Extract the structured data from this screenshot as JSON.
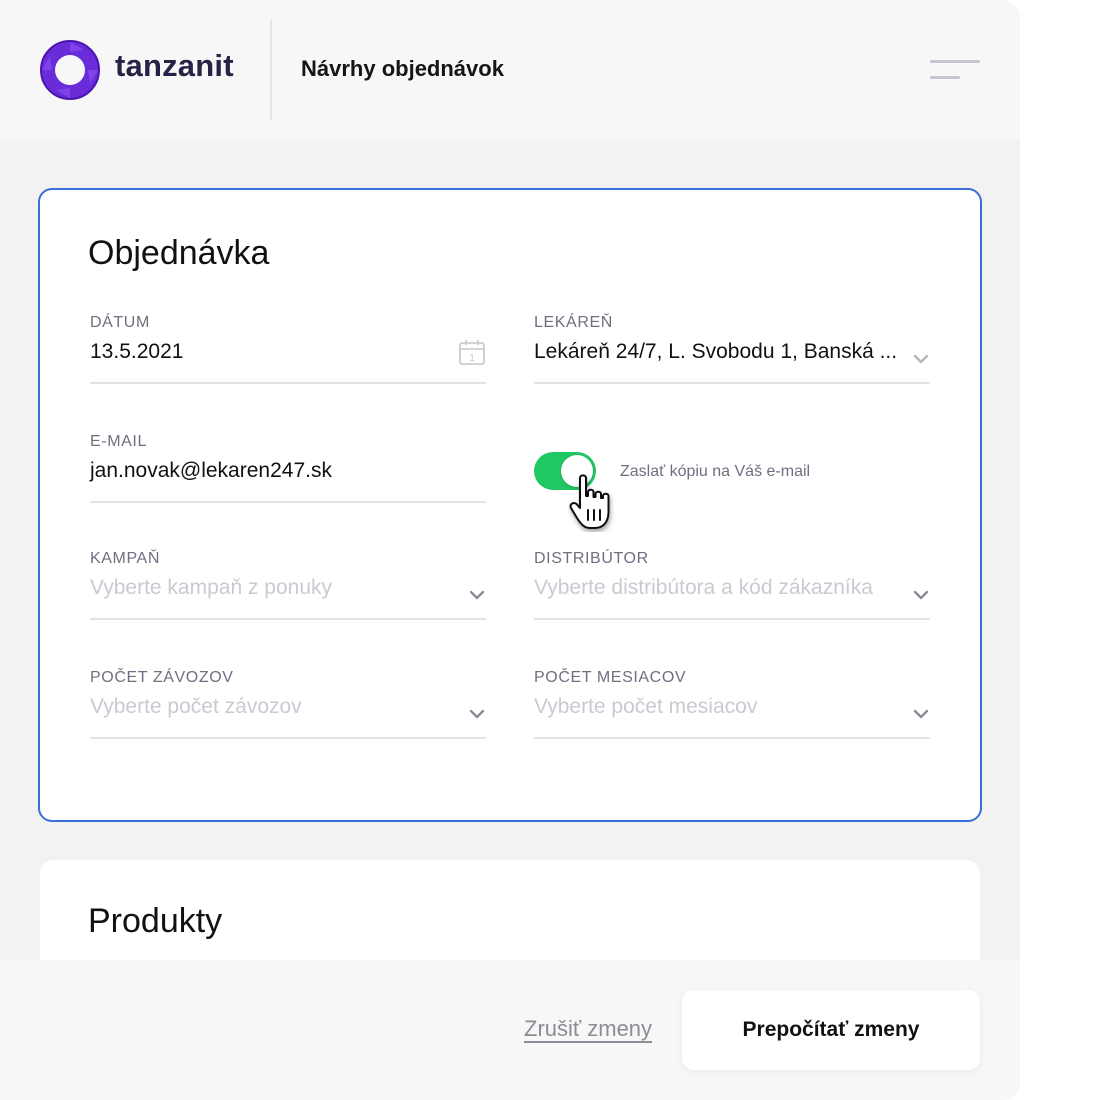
{
  "header": {
    "brand": "tanzanit",
    "page_title": "Návrhy objednávok"
  },
  "order_card": {
    "title": "Objednávka",
    "date": {
      "label": "DÁTUM",
      "value": "13.5.2021",
      "calendar_day": "1"
    },
    "pharmacy": {
      "label": "LEKÁREŇ",
      "value": "Lekáreň 24/7, L. Svobodu 1, Banská ..."
    },
    "email": {
      "label": "E-MAIL",
      "value": "jan.novak@lekaren247.sk"
    },
    "copy_toggle": {
      "label": "Zaslať kópiu na Váš e-mail",
      "on": true
    },
    "campaign": {
      "label": "KAMPAŇ",
      "placeholder": "Vyberte kampaň z ponuky"
    },
    "distributor": {
      "label": "DISTRIBÚTOR",
      "placeholder": "Vyberte distribútora a kód zákazníka"
    },
    "deliveries": {
      "label": "POČET ZÁVOZOV",
      "placeholder": "Vyberte počet závozov"
    },
    "months": {
      "label": "POČET MESIACOV",
      "placeholder": "Vyberte počet mesiacov"
    }
  },
  "products_card": {
    "title": "Produkty"
  },
  "footer": {
    "cancel_label": "Zrušiť zmeny",
    "recalculate_label": "Prepočítať zmeny"
  },
  "colors": {
    "accent_border": "#3a6fd8",
    "toggle_on": "#20c863",
    "brand_purple": "#6a2bd9",
    "brand_text": "#2a2246"
  },
  "icons": [
    "tanzanit-logo-icon",
    "menu-icon",
    "calendar-icon",
    "chevron-down-icon",
    "hand-cursor-icon"
  ]
}
